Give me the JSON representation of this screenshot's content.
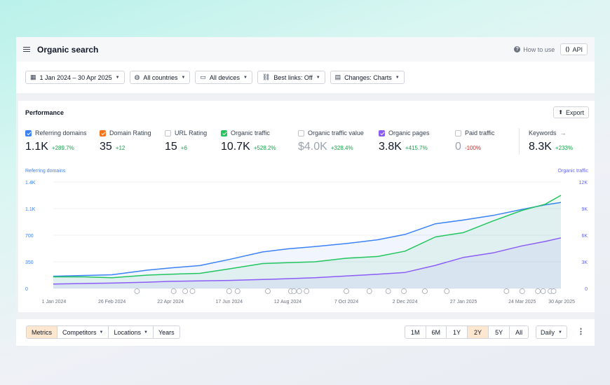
{
  "header": {
    "title": "Organic search",
    "how_to_use": "How to use",
    "api_label": "API"
  },
  "filters": [
    {
      "label": "1 Jan 2024 – 30 Apr 2025",
      "icon": "calendar-icon"
    },
    {
      "label": "All countries",
      "icon": "globe-icon"
    },
    {
      "label": "All devices",
      "icon": "monitor-icon"
    },
    {
      "label": "Best links: Off",
      "icon": "link-icon"
    },
    {
      "label": "Changes: Charts",
      "icon": "changes-icon"
    }
  ],
  "performance": {
    "title": "Performance",
    "export_label": "Export",
    "metrics": [
      {
        "label": "Referring domains",
        "value": "1.1K",
        "change": "+289.7%",
        "checked": true,
        "color": "#3b82f6"
      },
      {
        "label": "Domain Rating",
        "value": "35",
        "change": "+12",
        "checked": true,
        "color": "#f97316"
      },
      {
        "label": "URL Rating",
        "value": "15",
        "change": "+6",
        "checked": false,
        "color": ""
      },
      {
        "label": "Organic traffic",
        "value": "10.7K",
        "change": "+528.2%",
        "checked": true,
        "color": "#22c55e"
      },
      {
        "label": "Organic traffic value",
        "value": "$4.0K",
        "change": "+328.4%",
        "checked": false,
        "color": ""
      },
      {
        "label": "Organic pages",
        "value": "3.8K",
        "change": "+415.7%",
        "checked": true,
        "color": "#8b5cf6"
      },
      {
        "label": "Paid traffic",
        "value": "0",
        "change": "-100%",
        "checked": false,
        "color": ""
      }
    ],
    "keywords": {
      "label": "Keywords",
      "value": "8.3K",
      "change": "+233%"
    }
  },
  "chart_data": {
    "type": "line",
    "left_axis_label": "Referring domains",
    "right_axis_label": "Organic traffic",
    "left_ticks": [
      "1.4K",
      "1.1K",
      "700",
      "350",
      "0"
    ],
    "right_ticks": [
      "12K",
      "9K",
      "6K",
      "3K",
      "0"
    ],
    "ylim_left": [
      0,
      1400
    ],
    "ylim_right": [
      0,
      12000
    ],
    "x_tick_labels": [
      "1 Jan 2024",
      "26 Feb 2024",
      "22 Apr 2024",
      "17 Jun 2024",
      "12 Aug 2024",
      "7 Oct 2024",
      "2 Dec 2024",
      "27 Jan 2025",
      "24 Mar 2025",
      "30 Apr 2025"
    ],
    "x_ticks": [
      0,
      56,
      112,
      168,
      224,
      280,
      336,
      392,
      448,
      485
    ],
    "x_range": [
      0,
      485
    ],
    "grid": true,
    "series": [
      {
        "name": "Referring domains",
        "axis": "left",
        "color": "#3b82f6",
        "x": [
          0,
          30,
          56,
          90,
          112,
          140,
          168,
          200,
          224,
          250,
          280,
          310,
          336,
          365,
          392,
          420,
          448,
          470,
          485
        ],
        "y": [
          160,
          170,
          180,
          240,
          270,
          300,
          380,
          480,
          520,
          550,
          590,
          640,
          710,
          850,
          900,
          960,
          1040,
          1100,
          1130
        ]
      },
      {
        "name": "Organic traffic",
        "axis": "right",
        "color": "#22c55e",
        "x": [
          0,
          30,
          56,
          90,
          112,
          140,
          168,
          200,
          224,
          250,
          280,
          310,
          336,
          365,
          392,
          420,
          448,
          470,
          485
        ],
        "y": [
          1300,
          1300,
          1200,
          1500,
          1600,
          1700,
          2200,
          2800,
          2900,
          3000,
          3400,
          3600,
          4200,
          5800,
          6300,
          7600,
          8800,
          9500,
          10500
        ]
      },
      {
        "name": "Organic pages",
        "axis": "right",
        "color": "#8b5cf6",
        "x": [
          0,
          30,
          56,
          90,
          112,
          140,
          168,
          200,
          224,
          250,
          280,
          310,
          336,
          365,
          392,
          420,
          448,
          470,
          485
        ],
        "y": [
          500,
          550,
          600,
          700,
          800,
          850,
          900,
          1000,
          1100,
          1200,
          1400,
          1600,
          1800,
          2600,
          3500,
          4000,
          4800,
          5300,
          5700
        ]
      }
    ],
    "annotation_markers_x": [
      80,
      115,
      126,
      133,
      168,
      176,
      205,
      227,
      230,
      235,
      242,
      280,
      302,
      320,
      335,
      355,
      376,
      433,
      448,
      463,
      468,
      475,
      478
    ]
  },
  "bottombar": {
    "left_tabs": [
      {
        "label": "Metrics",
        "active": true,
        "dropdown": false
      },
      {
        "label": "Competitors",
        "active": false,
        "dropdown": true
      },
      {
        "label": "Locations",
        "active": false,
        "dropdown": true
      },
      {
        "label": "Years",
        "active": false,
        "dropdown": false
      }
    ],
    "ranges": [
      {
        "label": "1M",
        "active": false
      },
      {
        "label": "6M",
        "active": false
      },
      {
        "label": "1Y",
        "active": false
      },
      {
        "label": "2Y",
        "active": true
      },
      {
        "label": "5Y",
        "active": false
      },
      {
        "label": "All",
        "active": false
      }
    ],
    "granularity": "Daily"
  }
}
